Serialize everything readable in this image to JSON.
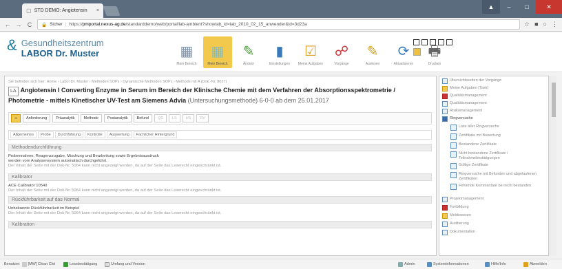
{
  "browser": {
    "tab_title": "STD DEMO: Angiotensin",
    "tab_close": "×",
    "url_secure": "Sicher",
    "url_rest": "https://",
    "url_domain": "pmportal.nexus-ag.de",
    "url_path": "/standarddemo/web/portal/lab-ambient?showtab_id=lab_2010_02_15_anwender&id=3d23a"
  },
  "app": {
    "logo_line1": "Gesundheitszentrum",
    "logo_line2": "LABOR Dr. Muster",
    "buttons": [
      {
        "label": "Mein Bereich",
        "icon": "▦"
      },
      {
        "label": "Mein Bereich",
        "icon": "▦"
      },
      {
        "label": "Ändern",
        "icon": "✎"
      },
      {
        "label": "Einstellungen",
        "icon": "▮"
      },
      {
        "label": "Meine Aufgaben",
        "icon": "☑"
      },
      {
        "label": "Vorgänge",
        "icon": "☍"
      },
      {
        "label": "Auslesen",
        "icon": "✎"
      },
      {
        "label": "Aktualisieren",
        "icon": "⟳"
      },
      {
        "label": "Drucken",
        "icon": "🖶"
      }
    ]
  },
  "main": {
    "breadcrumb": "Sie befinden sich hier: Home › Labor Dr. Muster › Methoden SOPs › Dynamische Methoden SOPs › Methode mit A (Dok.-Nr. 8027)",
    "doc_badge": "LA",
    "title_bold": "Angiotensin I Converting Enzyme in Serum im Bereich der Klinische Chemie mit dem Verfahren der Absorptionsspektrometrie / Photometrie - mittels Kinetischer UV-Test am Siemens Advia",
    "title_sub": "(Untersuchungsmethode) 6-0-0 ab dem 25.01.2017",
    "status_tabs": [
      "Anforderung",
      "Präanalytik",
      "Methode",
      "Postanalytik",
      "Befund",
      "QS",
      "LS",
      "HS",
      "RV"
    ],
    "sub_tabs": [
      "Allgemeines",
      "Probe",
      "Durchführung",
      "Kontrolle",
      "Auswertung",
      "Fachlicher Hintergrund"
    ],
    "sections": [
      {
        "heading": "Methodendurchführung",
        "lines": [
          "Probennahme, Reagenzzugabe, Mischung und Bearbeitung sowie Ergebnisausdruck",
          "werden vom Analysensystem automatisch durchgeführt."
        ],
        "missing": "Der Inhalt der Seite mit der Dok-Nr. 5064 kann nicht angezeigt werden, da auf der Seite das Leserecht eingeschränkt ist."
      },
      {
        "heading": "Kalibrator",
        "lines": [
          "ACE Calibrator 10540"
        ],
        "missing": "Der Inhalt der Seite mit der Dok-Nr. 5064 kann nicht angezeigt werden, da auf der Seite das Leserecht eingeschränkt ist."
      },
      {
        "heading": "Rückführbarkeit auf das Normal",
        "lines": [
          "Unbekannte Rückführbarkeit im Beispiel"
        ],
        "missing": "Der Inhalt der Seite mit der Dok-Nr. 5064 kann nicht angezeigt werden, da auf der Seite das Leserecht eingeschränkt ist."
      },
      {
        "heading": "Kalibration",
        "lines": [],
        "missing": ""
      }
    ]
  },
  "sidebar": {
    "items": [
      "Übersichtsseiten der Vorgänge",
      "Meine Aufgaben (Task)",
      "Qualitätsmanagement",
      "Qualitätsmanagement",
      "Risikomanagement",
      "Ringversuche",
      "Liste aller Ringversuche",
      "Zertifikate mit Bewertung",
      "Bestandene Zertifikate",
      "Nicht bestandene Zertifikate / Teilnahmebestätigungen",
      "Gültige Zertifikate",
      "Ringversuche mit Befunden und abgelaufenen Zertifikaten",
      "Fehlende Kommentare bei nicht bestanden",
      "Projektmanagement",
      "Fortbildung",
      "Meldewesen",
      "Auditierung",
      "Dokumentation"
    ]
  },
  "footer": {
    "left1": "Benutzer: ",
    "left2": "[MW] Clean Clei",
    "left3": "Lesebestätigung",
    "left4": "Umfang und Version",
    "right1": "Admin",
    "right2": "Systeminformationen",
    "right3": "Hilfe/Info",
    "right4": "Abmelden"
  }
}
